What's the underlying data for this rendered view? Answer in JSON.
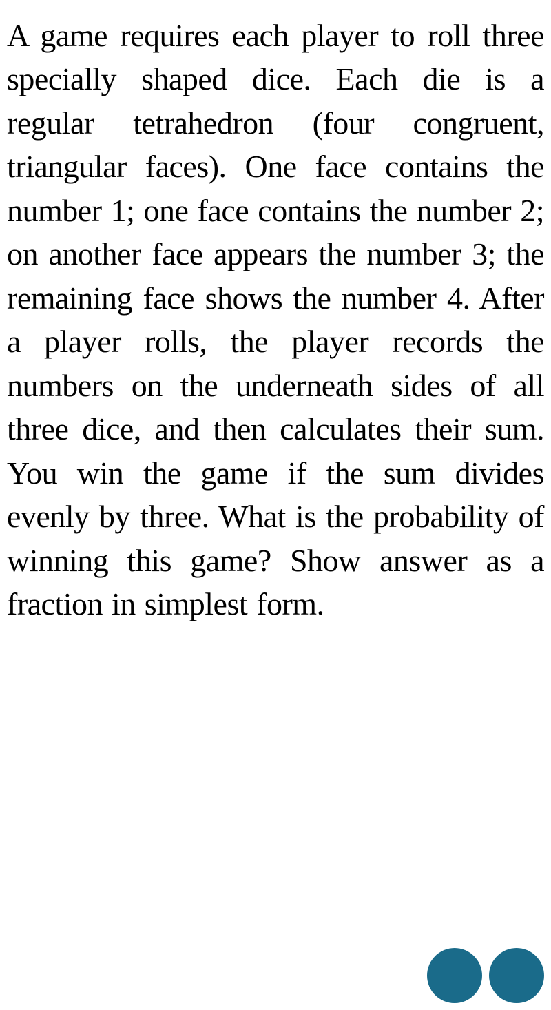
{
  "content": {
    "paragraph": "A game requires each player to roll three specially shaped dice. Each die is a regular tetrahedron (four congruent, triangular faces). One face contains the number 1; one face contains the number 2; on another face appears the number 3; the remaining face shows the number 4. After a player rolls, the player records the numbers on the underneath sides of all three dice, and then calculates their sum. You win the game if the sum divides evenly by three. What is the probability of winning this game? Show answer as a fraction in simplest form."
  },
  "circles": {
    "count": 2,
    "color": "#1a6b8a"
  }
}
